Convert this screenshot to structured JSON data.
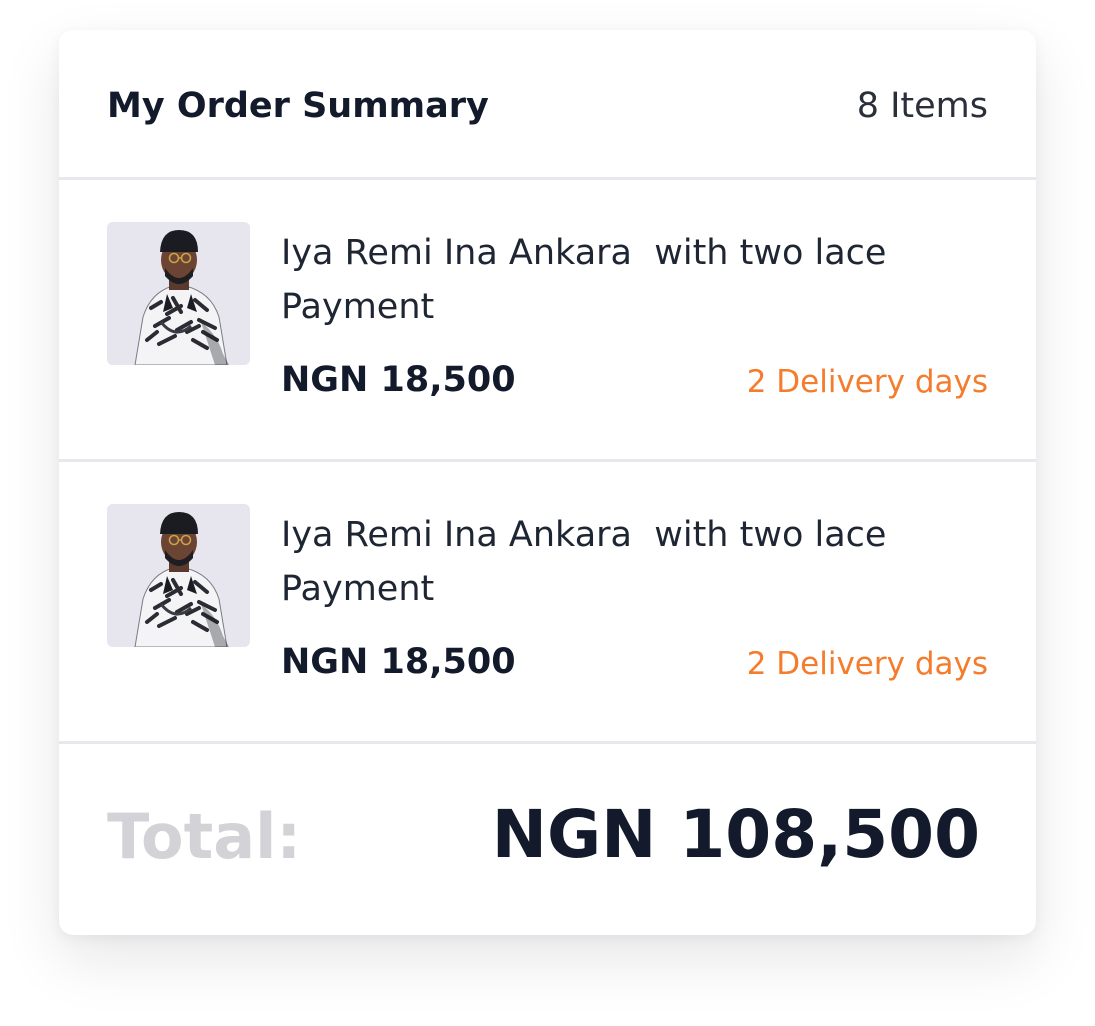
{
  "summary": {
    "title": "My Order Summary",
    "item_count": "8 Items"
  },
  "items": [
    {
      "name": "Iya Remi Ina Ankara  with two lace Payment",
      "price": "NGN 18,500",
      "delivery": "2 Delivery days"
    },
    {
      "name": "Iya Remi Ina Ankara  with two lace Payment",
      "price": "NGN 18,500",
      "delivery": "2 Delivery days"
    }
  ],
  "total": {
    "label": "Total:",
    "value": "NGN 108,500"
  },
  "colors": {
    "accent_orange": "#f47c2c",
    "text_dark": "#121a2b",
    "total_label_gray": "#d3d3d7",
    "divider": "#e7e8eb"
  }
}
